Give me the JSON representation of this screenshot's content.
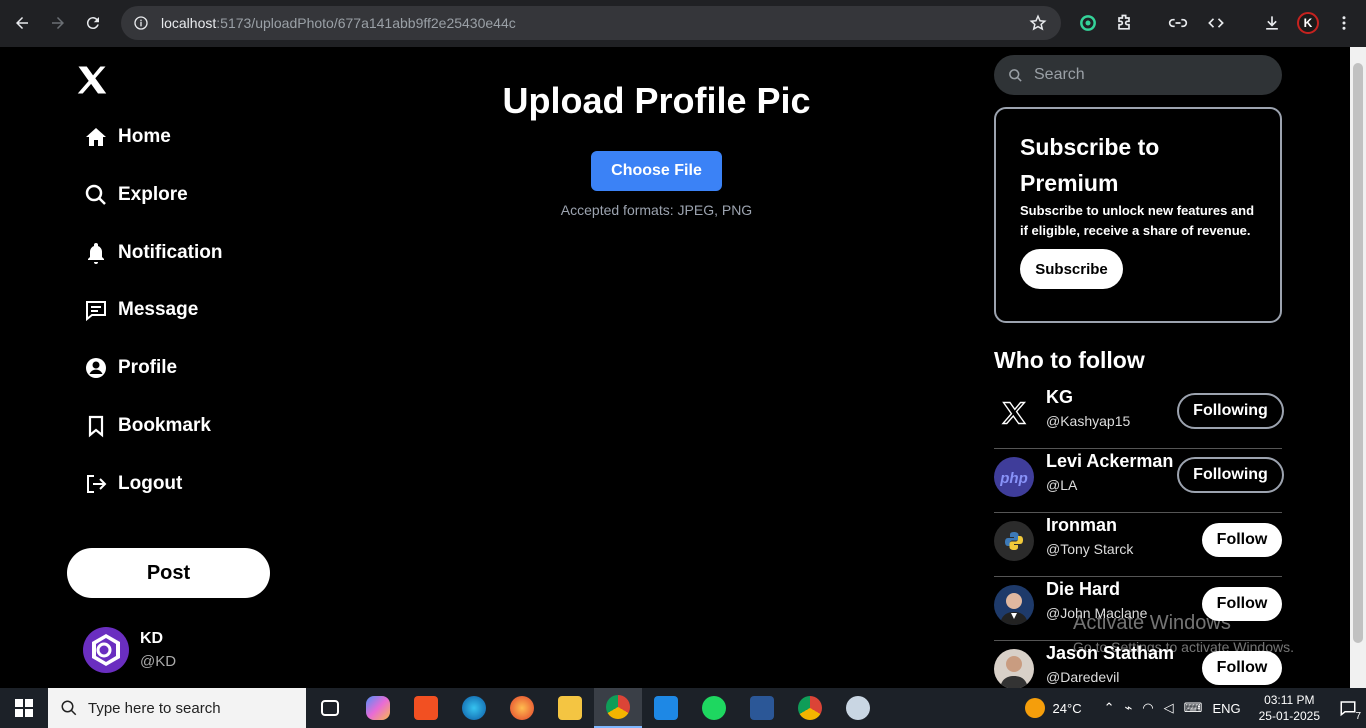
{
  "browser": {
    "url_host": "localhost",
    "url_path": ":5173/uploadPhoto/677a141abb9ff2e25430e44c",
    "profile_initial": "K"
  },
  "sidebar": {
    "items": [
      {
        "label": "Home",
        "icon": "home-icon"
      },
      {
        "label": "Explore",
        "icon": "search-icon"
      },
      {
        "label": "Notification",
        "icon": "bell-icon"
      },
      {
        "label": "Message",
        "icon": "message-icon"
      },
      {
        "label": "Profile",
        "icon": "user-icon"
      },
      {
        "label": "Bookmark",
        "icon": "bookmark-icon"
      },
      {
        "label": "Logout",
        "icon": "logout-icon"
      }
    ],
    "post_label": "Post",
    "user": {
      "name": "KD",
      "handle": "@KD"
    }
  },
  "main": {
    "title": "Upload Profile Pic",
    "choose_label": "Choose File",
    "accepted": "Accepted formats: JPEG, PNG"
  },
  "right": {
    "search_placeholder": "Search",
    "premium": {
      "title": "Subscribe to Premium",
      "text": "Subscribe to unlock new features and if eligible, receive a share of revenue.",
      "button": "Subscribe"
    },
    "who_to_follow": "Who to follow",
    "follow_list": [
      {
        "name": "KG",
        "handle": "@Kashyap15",
        "status": "Following"
      },
      {
        "name": "Levi Ackerman",
        "handle": "@LA",
        "status": "Following"
      },
      {
        "name": "Ironman",
        "handle": "@Tony Starck",
        "status": "Follow"
      },
      {
        "name": "Die Hard",
        "handle": "@John Maclane",
        "status": "Follow"
      },
      {
        "name": "Jason Statham",
        "handle": "@Daredevil",
        "status": "Follow"
      }
    ]
  },
  "watermark": {
    "line1": "Activate Windows",
    "line2": "Go to Settings to activate Windows."
  },
  "taskbar": {
    "search_placeholder": "Type here to search",
    "weather": "24°C",
    "lang": "ENG",
    "time": "03:11 PM",
    "date": "25-01-2025",
    "notif_count": "7"
  },
  "colors": {
    "accent": "#3b82f6",
    "background": "#000000"
  }
}
